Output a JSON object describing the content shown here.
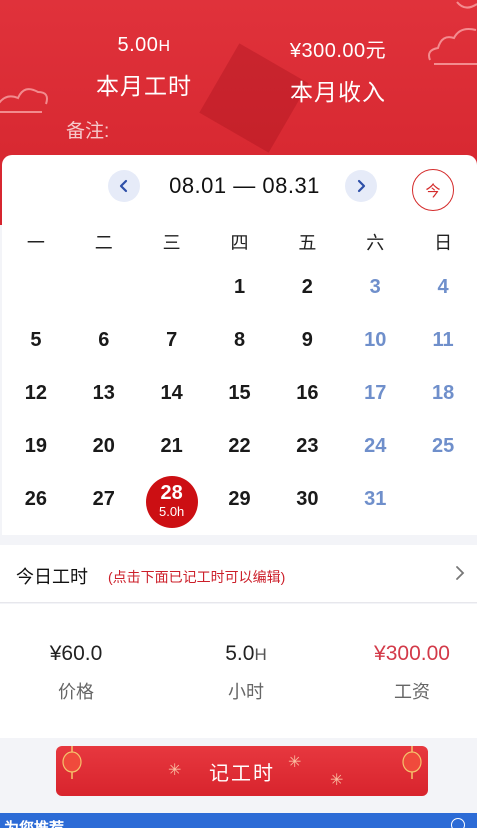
{
  "header": {
    "hours_value": "5.00",
    "hours_unit": "H",
    "hours_label": "本月工时",
    "income_value": "¥300.00元",
    "income_label": "本月收入",
    "remark_label": "备注:"
  },
  "calendar": {
    "range": "08.01 — 08.31",
    "today_label": "今",
    "prev_icon": "chevron-left-icon",
    "next_icon": "chevron-right-icon",
    "weekdays": [
      "一",
      "二",
      "三",
      "四",
      "五",
      "六",
      "日"
    ],
    "weeks": [
      [
        "",
        "",
        "",
        "1",
        "2",
        "3",
        "4"
      ],
      [
        "5",
        "6",
        "7",
        "8",
        "9",
        "10",
        "11"
      ],
      [
        "12",
        "13",
        "14",
        "15",
        "16",
        "17",
        "18"
      ],
      [
        "19",
        "20",
        "21",
        "22",
        "23",
        "24",
        "25"
      ],
      [
        "26",
        "27",
        "28",
        "29",
        "30",
        "31",
        ""
      ]
    ],
    "selected_day": "28",
    "selected_hours": "5.0h"
  },
  "today_row": {
    "title": "今日工时",
    "hint": "(点击下面已记工时可以编辑)"
  },
  "summary": {
    "price_value": "¥60.0",
    "price_label": "价格",
    "hours_value": "5.0",
    "hours_unit": "H",
    "hours_label": "小时",
    "wage_value": "¥300.00",
    "wage_label": "工资"
  },
  "record_button": {
    "label": "记工时"
  },
  "bottom_strip": {
    "text": "为您推荐"
  },
  "colors": {
    "header_red": "#d92a33",
    "selected_red": "#cc0f13",
    "weekend_blue": "#6f8fcb",
    "wage_red": "#d33a49",
    "bottom_blue": "#2c6bd6"
  }
}
